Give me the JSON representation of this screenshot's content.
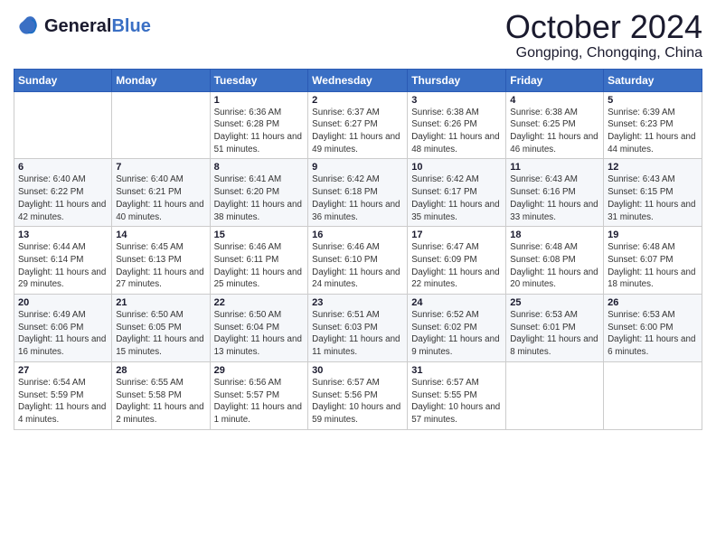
{
  "header": {
    "logo_general": "General",
    "logo_blue": "Blue",
    "month_title": "October 2024",
    "location": "Gongping, Chongqing, China"
  },
  "days_of_week": [
    "Sunday",
    "Monday",
    "Tuesday",
    "Wednesday",
    "Thursday",
    "Friday",
    "Saturday"
  ],
  "weeks": [
    [
      {
        "day": "",
        "info": ""
      },
      {
        "day": "",
        "info": ""
      },
      {
        "day": "1",
        "info": "Sunrise: 6:36 AM\nSunset: 6:28 PM\nDaylight: 11 hours and 51 minutes."
      },
      {
        "day": "2",
        "info": "Sunrise: 6:37 AM\nSunset: 6:27 PM\nDaylight: 11 hours and 49 minutes."
      },
      {
        "day": "3",
        "info": "Sunrise: 6:38 AM\nSunset: 6:26 PM\nDaylight: 11 hours and 48 minutes."
      },
      {
        "day": "4",
        "info": "Sunrise: 6:38 AM\nSunset: 6:25 PM\nDaylight: 11 hours and 46 minutes."
      },
      {
        "day": "5",
        "info": "Sunrise: 6:39 AM\nSunset: 6:23 PM\nDaylight: 11 hours and 44 minutes."
      }
    ],
    [
      {
        "day": "6",
        "info": "Sunrise: 6:40 AM\nSunset: 6:22 PM\nDaylight: 11 hours and 42 minutes."
      },
      {
        "day": "7",
        "info": "Sunrise: 6:40 AM\nSunset: 6:21 PM\nDaylight: 11 hours and 40 minutes."
      },
      {
        "day": "8",
        "info": "Sunrise: 6:41 AM\nSunset: 6:20 PM\nDaylight: 11 hours and 38 minutes."
      },
      {
        "day": "9",
        "info": "Sunrise: 6:42 AM\nSunset: 6:18 PM\nDaylight: 11 hours and 36 minutes."
      },
      {
        "day": "10",
        "info": "Sunrise: 6:42 AM\nSunset: 6:17 PM\nDaylight: 11 hours and 35 minutes."
      },
      {
        "day": "11",
        "info": "Sunrise: 6:43 AM\nSunset: 6:16 PM\nDaylight: 11 hours and 33 minutes."
      },
      {
        "day": "12",
        "info": "Sunrise: 6:43 AM\nSunset: 6:15 PM\nDaylight: 11 hours and 31 minutes."
      }
    ],
    [
      {
        "day": "13",
        "info": "Sunrise: 6:44 AM\nSunset: 6:14 PM\nDaylight: 11 hours and 29 minutes."
      },
      {
        "day": "14",
        "info": "Sunrise: 6:45 AM\nSunset: 6:13 PM\nDaylight: 11 hours and 27 minutes."
      },
      {
        "day": "15",
        "info": "Sunrise: 6:46 AM\nSunset: 6:11 PM\nDaylight: 11 hours and 25 minutes."
      },
      {
        "day": "16",
        "info": "Sunrise: 6:46 AM\nSunset: 6:10 PM\nDaylight: 11 hours and 24 minutes."
      },
      {
        "day": "17",
        "info": "Sunrise: 6:47 AM\nSunset: 6:09 PM\nDaylight: 11 hours and 22 minutes."
      },
      {
        "day": "18",
        "info": "Sunrise: 6:48 AM\nSunset: 6:08 PM\nDaylight: 11 hours and 20 minutes."
      },
      {
        "day": "19",
        "info": "Sunrise: 6:48 AM\nSunset: 6:07 PM\nDaylight: 11 hours and 18 minutes."
      }
    ],
    [
      {
        "day": "20",
        "info": "Sunrise: 6:49 AM\nSunset: 6:06 PM\nDaylight: 11 hours and 16 minutes."
      },
      {
        "day": "21",
        "info": "Sunrise: 6:50 AM\nSunset: 6:05 PM\nDaylight: 11 hours and 15 minutes."
      },
      {
        "day": "22",
        "info": "Sunrise: 6:50 AM\nSunset: 6:04 PM\nDaylight: 11 hours and 13 minutes."
      },
      {
        "day": "23",
        "info": "Sunrise: 6:51 AM\nSunset: 6:03 PM\nDaylight: 11 hours and 11 minutes."
      },
      {
        "day": "24",
        "info": "Sunrise: 6:52 AM\nSunset: 6:02 PM\nDaylight: 11 hours and 9 minutes."
      },
      {
        "day": "25",
        "info": "Sunrise: 6:53 AM\nSunset: 6:01 PM\nDaylight: 11 hours and 8 minutes."
      },
      {
        "day": "26",
        "info": "Sunrise: 6:53 AM\nSunset: 6:00 PM\nDaylight: 11 hours and 6 minutes."
      }
    ],
    [
      {
        "day": "27",
        "info": "Sunrise: 6:54 AM\nSunset: 5:59 PM\nDaylight: 11 hours and 4 minutes."
      },
      {
        "day": "28",
        "info": "Sunrise: 6:55 AM\nSunset: 5:58 PM\nDaylight: 11 hours and 2 minutes."
      },
      {
        "day": "29",
        "info": "Sunrise: 6:56 AM\nSunset: 5:57 PM\nDaylight: 11 hours and 1 minute."
      },
      {
        "day": "30",
        "info": "Sunrise: 6:57 AM\nSunset: 5:56 PM\nDaylight: 10 hours and 59 minutes."
      },
      {
        "day": "31",
        "info": "Sunrise: 6:57 AM\nSunset: 5:55 PM\nDaylight: 10 hours and 57 minutes."
      },
      {
        "day": "",
        "info": ""
      },
      {
        "day": "",
        "info": ""
      }
    ]
  ]
}
